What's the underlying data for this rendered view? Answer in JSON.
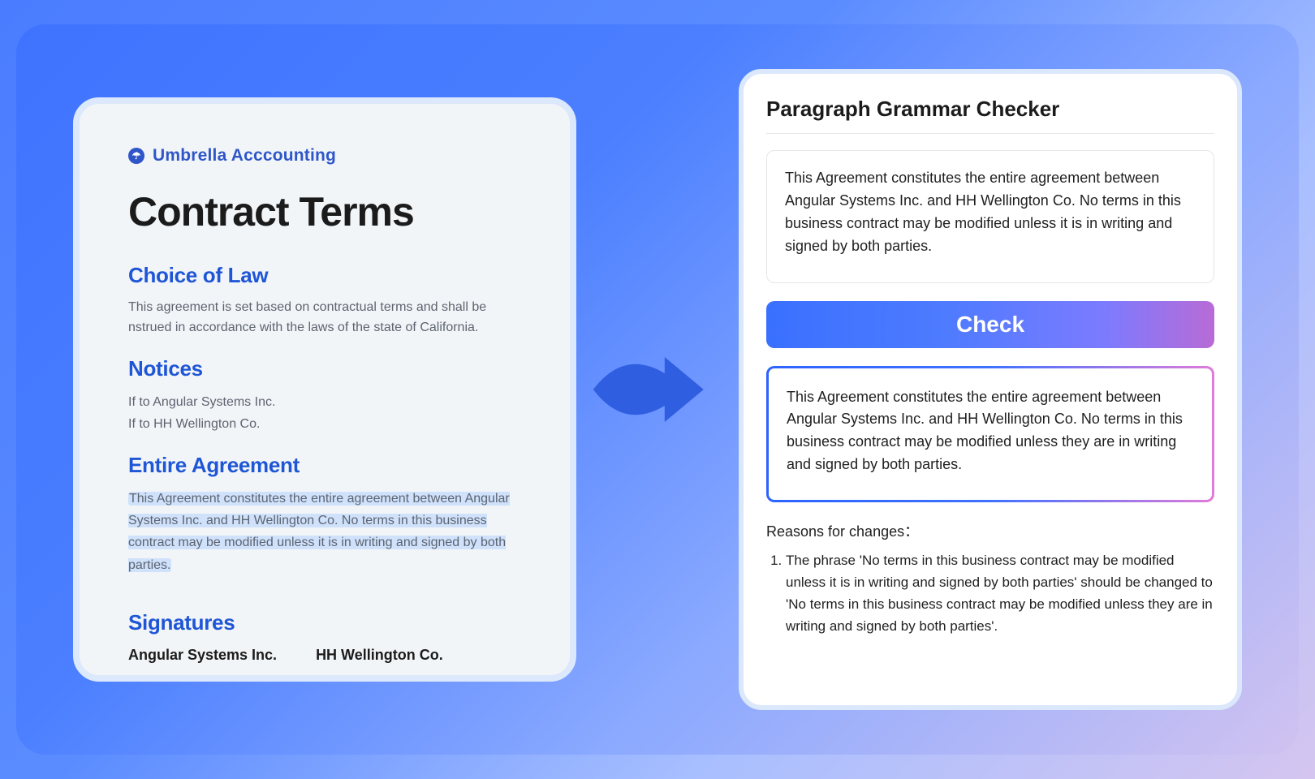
{
  "left": {
    "brand": "Umbrella Acccounting",
    "title": "Contract Terms",
    "sections": {
      "law": {
        "heading": "Choice of Law",
        "body": "This agreement is set based on contractual terms and shall be nstrued in accordance with the laws of the state of California."
      },
      "notices": {
        "heading": "Notices",
        "line1": "If to Angular Systems Inc.",
        "line2": "If to HH Wellington Co."
      },
      "entire": {
        "heading": "Entire Agreement",
        "body": "This Agreement constitutes the entire agreement between Angular Systems Inc. and HH Wellington Co. No terms in this business contract may be modified unless it is in writing and signed by both parties."
      },
      "signatures": {
        "heading": "Signatures",
        "name1": "Angular Systems Inc.",
        "name2": "HH Wellington Co."
      }
    }
  },
  "right": {
    "title": "Paragraph Grammar Checker",
    "input_text": "This Agreement constitutes the entire agreement between Angular Systems Inc. and HH Wellington Co. No terms in this business contract may be modified unless it is in writing and signed by both parties.",
    "check_label": "Check",
    "output_text": "This Agreement constitutes the entire agreement between Angular Systems Inc. and HH Wellington Co. No terms in this business contract may be modified unless they are in writing and signed by both parties.",
    "reasons_label": "Reasons for changes：",
    "reasons": [
      "The phrase 'No terms in this business contract may be modified unless it is in writing and signed by both parties' should be changed to 'No terms in this business contract may be modified unless they are in writing and signed by both parties'."
    ]
  }
}
